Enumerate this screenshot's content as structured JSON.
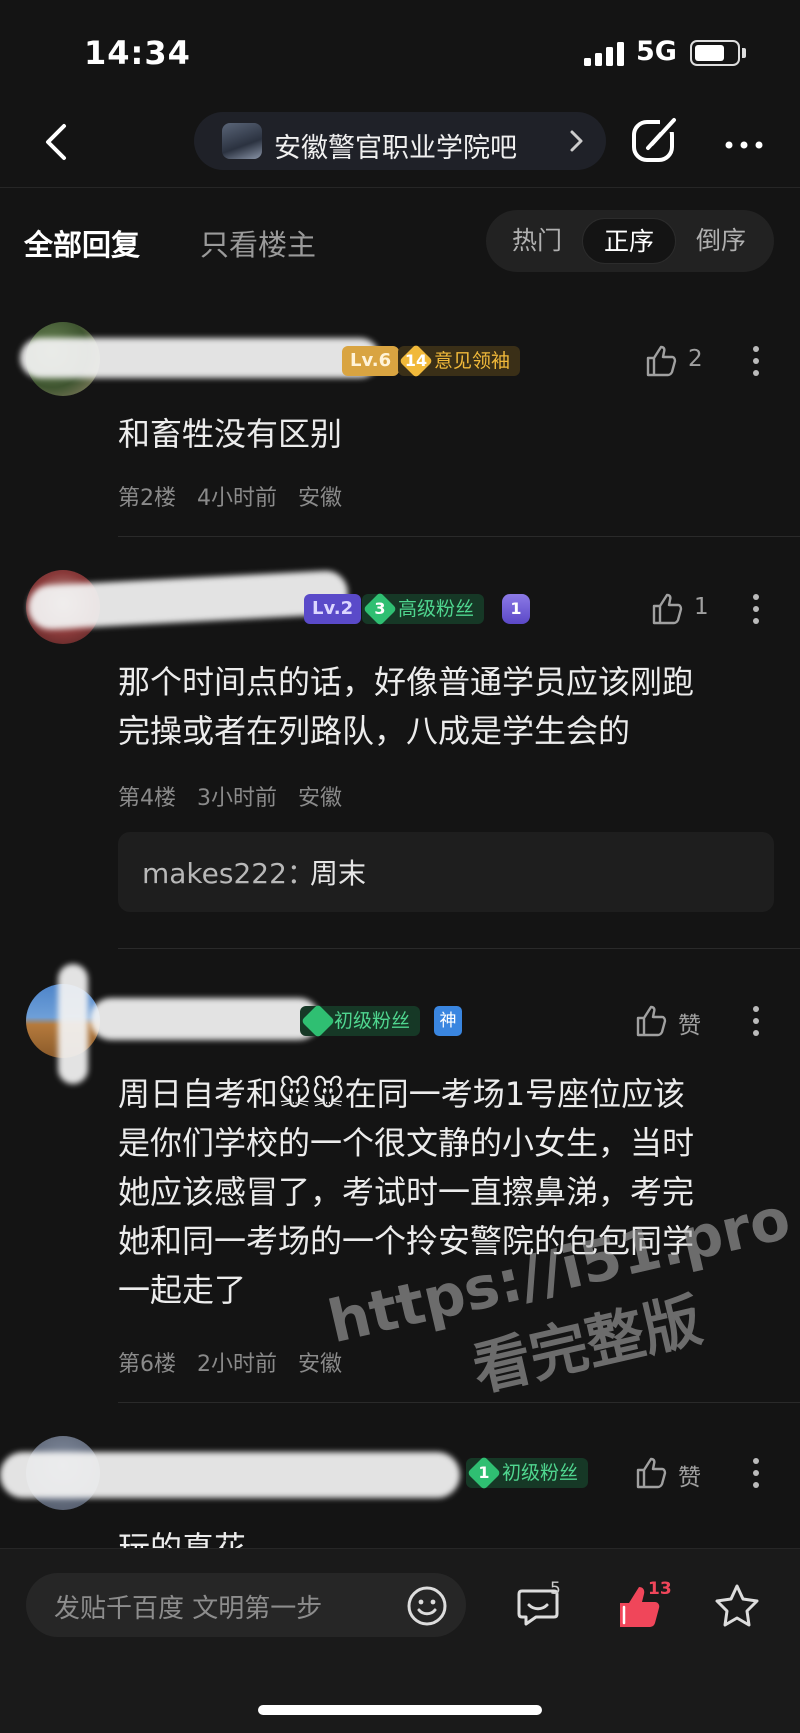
{
  "status_bar": {
    "time": "14:34",
    "network": "5G"
  },
  "nav": {
    "forum_name": "安徽警官职业学院吧"
  },
  "filters": {
    "tab_all": "全部回复",
    "tab_owner": "只看楼主",
    "sort_options": [
      "热门",
      "正序",
      "倒序"
    ],
    "sort_selected": "正序"
  },
  "posts": [
    {
      "level_badge": "Lv.6",
      "fan_level": "14",
      "fan_title": "意见领袖",
      "likes": "2",
      "text": "和畜牲没有区别",
      "floor": "第2楼",
      "time": "4小时前",
      "location": "安徽"
    },
    {
      "level_badge": "Lv.2",
      "fan_level": "3",
      "fan_title": "高级粉丝",
      "extra_badge": "1",
      "likes": "1",
      "text_lines": [
        "那个时间点的话，好像普通学员应该刚跑",
        "完操或者在列路队，八成是学生会的"
      ],
      "floor": "第4楼",
      "time": "3小时前",
      "location": "安徽",
      "sub_reply": {
        "user": "makes222：",
        "text": "周末"
      }
    },
    {
      "fan_title": "初级粉丝",
      "special_badge": "神",
      "likes": "赞",
      "text_lines": [
        "周日自考和🐭🐭在同一考场1号座位应该",
        "是你们学校的一个很文静的小女生，当时",
        "她应该感冒了，考试时一直擦鼻涕，考完",
        "她和同一考场的一个拎安警院的包包同学",
        "一起走了"
      ],
      "floor": "第6楼",
      "time": "2小时前",
      "location": "安徽"
    },
    {
      "fan_level": "1",
      "fan_title": "初级粉丝",
      "likes": "赞",
      "text": "玩的真花"
    }
  ],
  "watermark": {
    "line1": "https://i51.pro",
    "line2": "看完整版"
  },
  "bottom_bar": {
    "placeholder": "发贴千百度 文明第一步",
    "comment_count": "5",
    "like_count": "13"
  },
  "colors": {
    "background": "#141414",
    "gold_badge": "#c89a2c",
    "green_badge": "#2fbf72",
    "purple_badge": "#6d5bd6",
    "like_red": "#f0465a"
  }
}
